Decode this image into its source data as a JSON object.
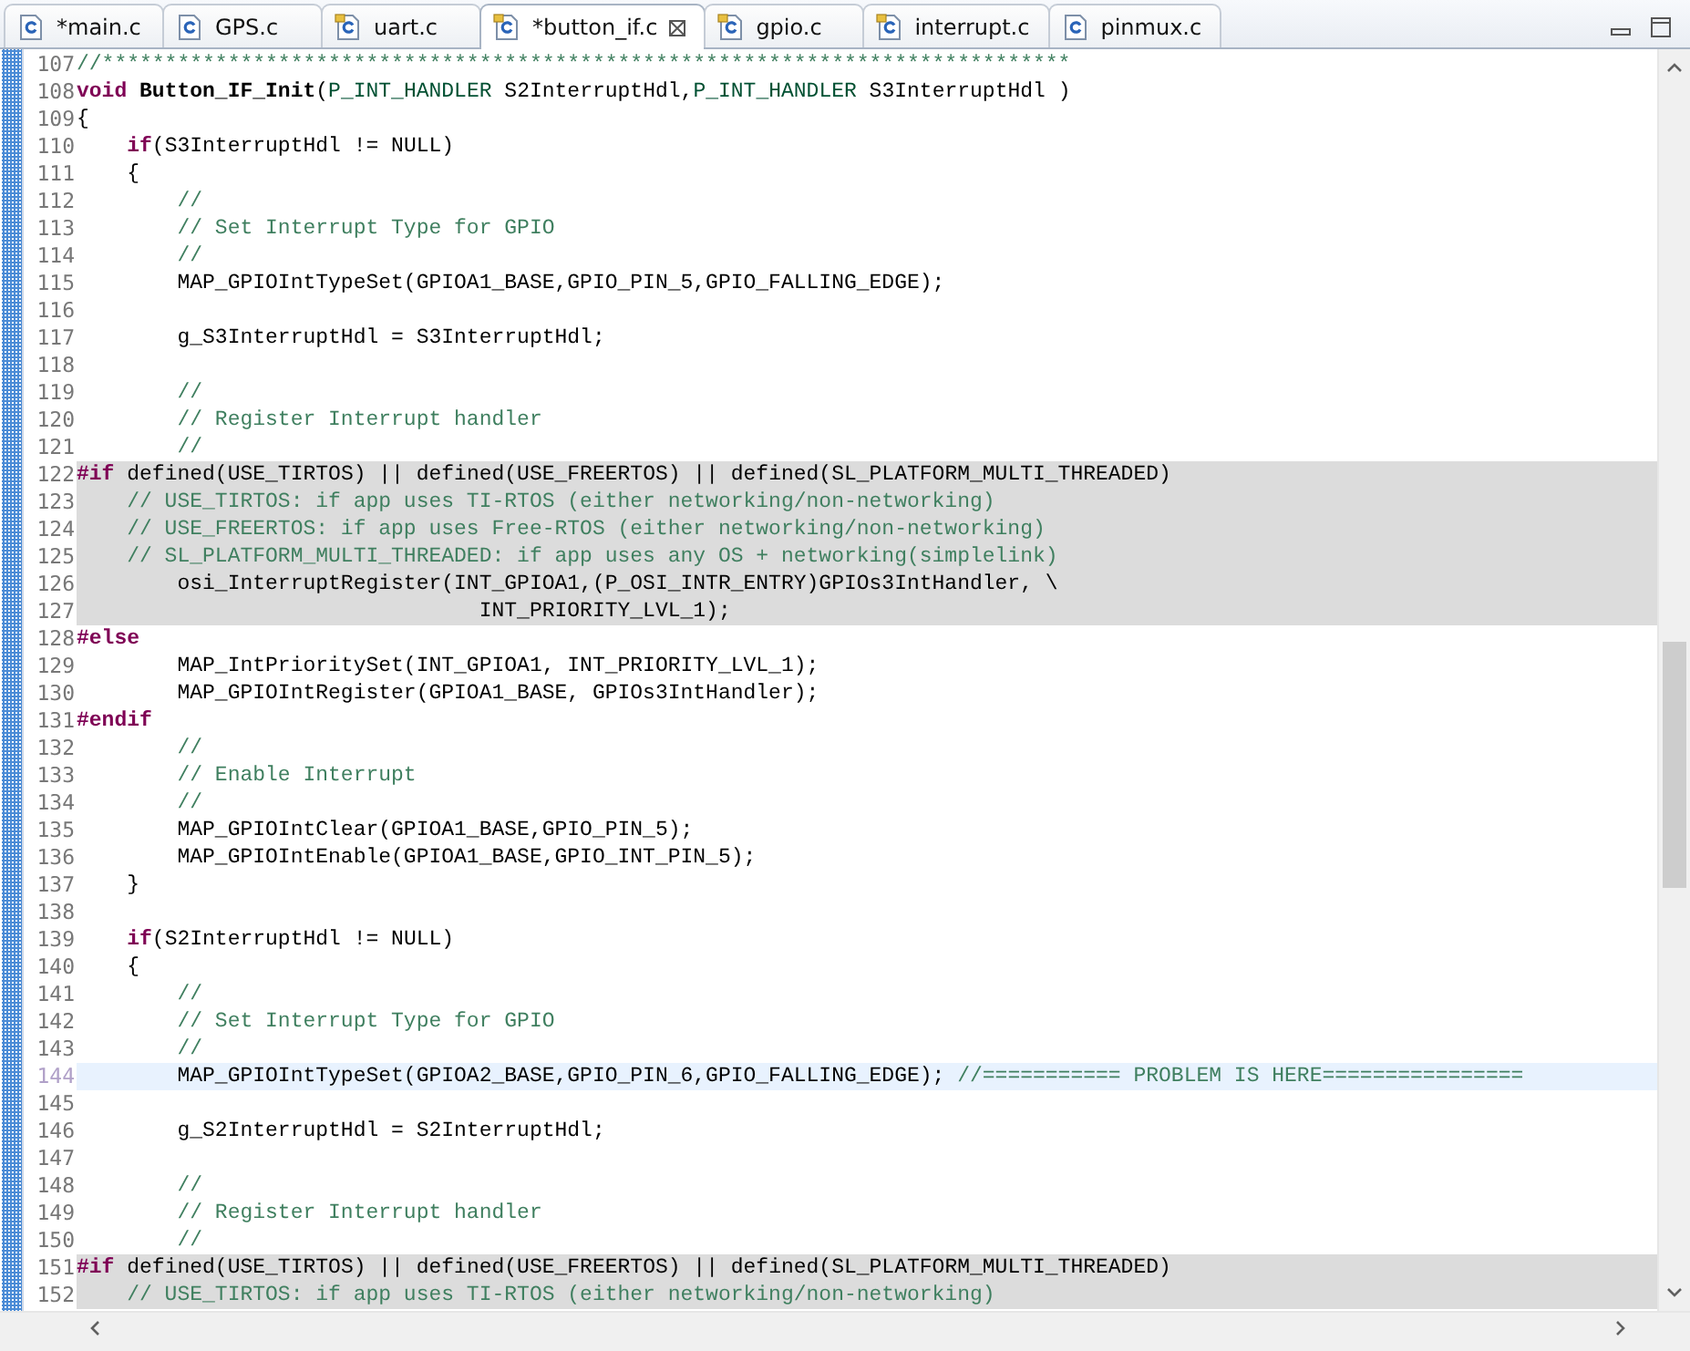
{
  "tabs": [
    {
      "label": "*main.c",
      "kind": "plain",
      "selected": false
    },
    {
      "label": "GPS.c",
      "kind": "plain",
      "selected": false
    },
    {
      "label": "uart.c",
      "kind": "tagged",
      "selected": false
    },
    {
      "label": "*button_if.c",
      "kind": "tagged",
      "selected": true
    },
    {
      "label": "gpio.c",
      "kind": "tagged",
      "selected": false
    },
    {
      "label": "interrupt.c",
      "kind": "tagged",
      "selected": false
    },
    {
      "label": "pinmux.c",
      "kind": "plain",
      "selected": false
    }
  ],
  "editor": {
    "lines": [
      {
        "number": "107",
        "kind": "normal",
        "spans": [
          {
            "kind": "comment",
            "text": "//*****************************************************************************"
          }
        ]
      },
      {
        "number": "108",
        "kind": "normal",
        "spans": [
          {
            "kind": "keyword",
            "text": "void"
          },
          {
            "kind": "function",
            "text": " Button_IF_Init"
          },
          {
            "kind": "plain",
            "text": "("
          },
          {
            "kind": "type",
            "text": "P_INT_HANDLER"
          },
          {
            "kind": "plain",
            "text": " S2InterruptHdl,"
          },
          {
            "kind": "type",
            "text": "P_INT_HANDLER"
          },
          {
            "kind": "plain",
            "text": " S3InterruptHdl )"
          }
        ]
      },
      {
        "number": "109",
        "kind": "normal",
        "spans": [
          {
            "kind": "plain",
            "text": "{"
          }
        ]
      },
      {
        "number": "110",
        "kind": "normal",
        "spans": [
          {
            "kind": "keyword",
            "text": "    if"
          },
          {
            "kind": "plain",
            "text": "(S3InterruptHdl != NULL)"
          }
        ]
      },
      {
        "number": "111",
        "kind": "normal",
        "spans": [
          {
            "kind": "plain",
            "text": "    {"
          }
        ]
      },
      {
        "number": "112",
        "kind": "normal",
        "spans": [
          {
            "kind": "comment",
            "text": "        //"
          }
        ]
      },
      {
        "number": "113",
        "kind": "normal",
        "spans": [
          {
            "kind": "comment",
            "text": "        // Set Interrupt Type for GPIO"
          }
        ]
      },
      {
        "number": "114",
        "kind": "normal",
        "spans": [
          {
            "kind": "comment",
            "text": "        //"
          }
        ]
      },
      {
        "number": "115",
        "kind": "normal",
        "spans": [
          {
            "kind": "plain",
            "text": "        MAP_GPIOIntTypeSet(GPIOA1_BASE,GPIO_PIN_5,GPIO_FALLING_EDGE);"
          }
        ]
      },
      {
        "number": "116",
        "kind": "normal"
      },
      {
        "number": "117",
        "kind": "normal",
        "spans": [
          {
            "kind": "plain",
            "text": "        g_S3InterruptHdl = S3InterruptHdl;"
          }
        ]
      },
      {
        "number": "118",
        "kind": "normal"
      },
      {
        "number": "119",
        "kind": "normal",
        "spans": [
          {
            "kind": "comment",
            "text": "        //"
          }
        ]
      },
      {
        "number": "120",
        "kind": "normal",
        "spans": [
          {
            "kind": "comment",
            "text": "        // Register Interrupt handler"
          }
        ]
      },
      {
        "number": "121",
        "kind": "normal",
        "spans": [
          {
            "kind": "comment",
            "text": "        //"
          }
        ]
      },
      {
        "number": "122",
        "kind": "inactive",
        "spans": [
          {
            "kind": "keyword",
            "text": "#if"
          },
          {
            "kind": "plain",
            "text": " defined(USE_TIRTOS) || defined(USE_FREERTOS) || defined(SL_PLATFORM_MULTI_THREADED)"
          }
        ]
      },
      {
        "number": "123",
        "kind": "inactive",
        "spans": [
          {
            "kind": "comment",
            "text": "    // USE_TIRTOS: if app uses TI-RTOS (either networking/non-networking)"
          }
        ]
      },
      {
        "number": "124",
        "kind": "inactive",
        "spans": [
          {
            "kind": "comment",
            "text": "    // USE_FREERTOS: if app uses Free-RTOS (either networking/non-networking)"
          }
        ]
      },
      {
        "number": "125",
        "kind": "inactive",
        "spans": [
          {
            "kind": "comment",
            "text": "    // SL_PLATFORM_MULTI_THREADED: if app uses any OS + networking(simplelink)"
          }
        ]
      },
      {
        "number": "126",
        "kind": "inactive",
        "spans": [
          {
            "kind": "plain",
            "text": "        osi_InterruptRegister(INT_GPIOA1,(P_OSI_INTR_ENTRY)GPIOs3IntHandler, \\"
          }
        ]
      },
      {
        "number": "127",
        "kind": "inactive",
        "spans": [
          {
            "kind": "plain",
            "text": "                                INT_PRIORITY_LVL_1);"
          }
        ]
      },
      {
        "number": "128",
        "kind": "normal",
        "spans": [
          {
            "kind": "keyword",
            "text": "#else"
          }
        ]
      },
      {
        "number": "129",
        "kind": "normal",
        "spans": [
          {
            "kind": "plain",
            "text": "        MAP_IntPrioritySet(INT_GPIOA1, INT_PRIORITY_LVL_1);"
          }
        ]
      },
      {
        "number": "130",
        "kind": "normal",
        "spans": [
          {
            "kind": "plain",
            "text": "        MAP_GPIOIntRegister(GPIOA1_BASE, GPIOs3IntHandler);"
          }
        ]
      },
      {
        "number": "131",
        "kind": "normal",
        "spans": [
          {
            "kind": "keyword",
            "text": "#endif"
          }
        ]
      },
      {
        "number": "132",
        "kind": "normal",
        "spans": [
          {
            "kind": "comment",
            "text": "        //"
          }
        ]
      },
      {
        "number": "133",
        "kind": "normal",
        "spans": [
          {
            "kind": "comment",
            "text": "        // Enable Interrupt"
          }
        ]
      },
      {
        "number": "134",
        "kind": "normal",
        "spans": [
          {
            "kind": "comment",
            "text": "        //"
          }
        ]
      },
      {
        "number": "135",
        "kind": "normal",
        "spans": [
          {
            "kind": "plain",
            "text": "        MAP_GPIOIntClear(GPIOA1_BASE,GPIO_PIN_5);"
          }
        ]
      },
      {
        "number": "136",
        "kind": "normal",
        "spans": [
          {
            "kind": "plain",
            "text": "        MAP_GPIOIntEnable(GPIOA1_BASE,GPIO_INT_PIN_5);"
          }
        ]
      },
      {
        "number": "137",
        "kind": "normal",
        "spans": [
          {
            "kind": "plain",
            "text": "    }"
          }
        ]
      },
      {
        "number": "138",
        "kind": "normal"
      },
      {
        "number": "139",
        "kind": "normal",
        "spans": [
          {
            "kind": "keyword",
            "text": "    if"
          },
          {
            "kind": "plain",
            "text": "(S2InterruptHdl != NULL)"
          }
        ]
      },
      {
        "number": "140",
        "kind": "normal",
        "spans": [
          {
            "kind": "plain",
            "text": "    {"
          }
        ]
      },
      {
        "number": "141",
        "kind": "normal",
        "spans": [
          {
            "kind": "comment",
            "text": "        //"
          }
        ]
      },
      {
        "number": "142",
        "kind": "normal",
        "spans": [
          {
            "kind": "comment",
            "text": "        // Set Interrupt Type for GPIO"
          }
        ]
      },
      {
        "number": "143",
        "kind": "normal",
        "spans": [
          {
            "kind": "comment",
            "text": "        //"
          }
        ]
      },
      {
        "number": "144",
        "kind": "current",
        "spans": [
          {
            "kind": "plain",
            "text": "        MAP_GPIOIntTypeSet(GPIOA2_BASE,GPIO_PIN_6,GPIO_FALLING_EDGE); "
          },
          {
            "kind": "comment",
            "text": "//=========== PROBLEM IS HERE================"
          }
        ]
      },
      {
        "number": "145",
        "kind": "normal"
      },
      {
        "number": "146",
        "kind": "normal",
        "spans": [
          {
            "kind": "plain",
            "text": "        g_S2InterruptHdl = S2InterruptHdl;"
          }
        ]
      },
      {
        "number": "147",
        "kind": "normal"
      },
      {
        "number": "148",
        "kind": "normal",
        "spans": [
          {
            "kind": "comment",
            "text": "        //"
          }
        ]
      },
      {
        "number": "149",
        "kind": "normal",
        "spans": [
          {
            "kind": "comment",
            "text": "        // Register Interrupt handler"
          }
        ]
      },
      {
        "number": "150",
        "kind": "normal",
        "spans": [
          {
            "kind": "comment",
            "text": "        //"
          }
        ]
      },
      {
        "number": "151",
        "kind": "inactive",
        "spans": [
          {
            "kind": "keyword",
            "text": "#if"
          },
          {
            "kind": "plain",
            "text": " defined(USE_TIRTOS) || defined(USE_FREERTOS) || defined(SL_PLATFORM_MULTI_THREADED)"
          }
        ]
      },
      {
        "number": "152",
        "kind": "inactive",
        "spans": [
          {
            "kind": "comment",
            "text": "    // USE_TIRTOS: if app uses TI-RTOS (either networking/non-networking)"
          }
        ]
      }
    ]
  }
}
